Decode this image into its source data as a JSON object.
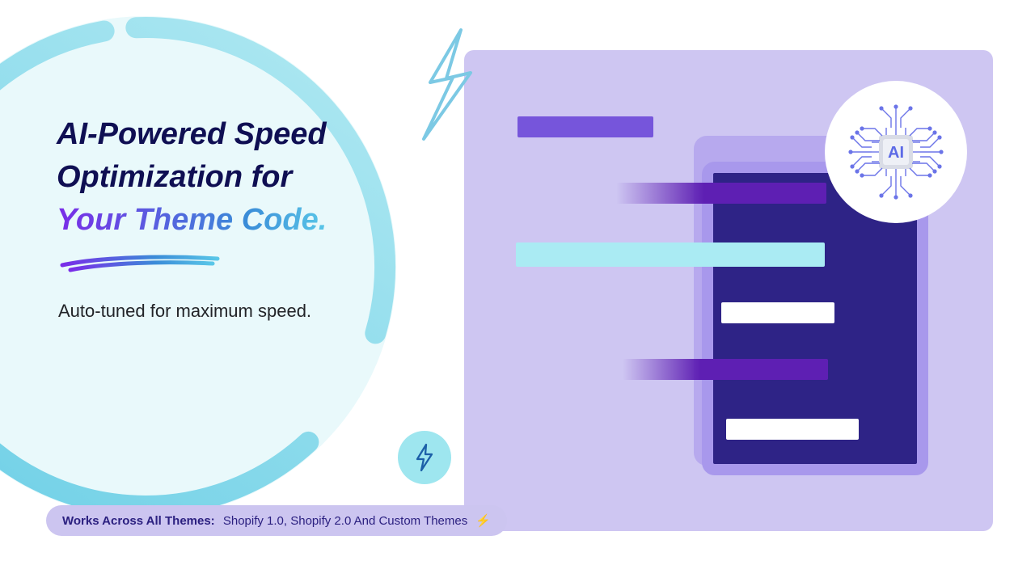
{
  "headline": {
    "line1": "AI-Powered Speed",
    "line2": "Optimization for",
    "line3": "Your Theme Code."
  },
  "subtitle": "Auto-tuned for maximum speed.",
  "pill": {
    "bold": "Works Across All Themes:",
    "rest": "Shopify 1.0, Shopify 2.0 And Custom Themes",
    "emoji": "⚡"
  },
  "ai_badge": {
    "label": "AI"
  },
  "colors": {
    "accent_blue": "#5AC7E8",
    "accent_purple": "#7A2CE8",
    "panel": "#CEC6F2",
    "doc_front": "#2E2386"
  }
}
